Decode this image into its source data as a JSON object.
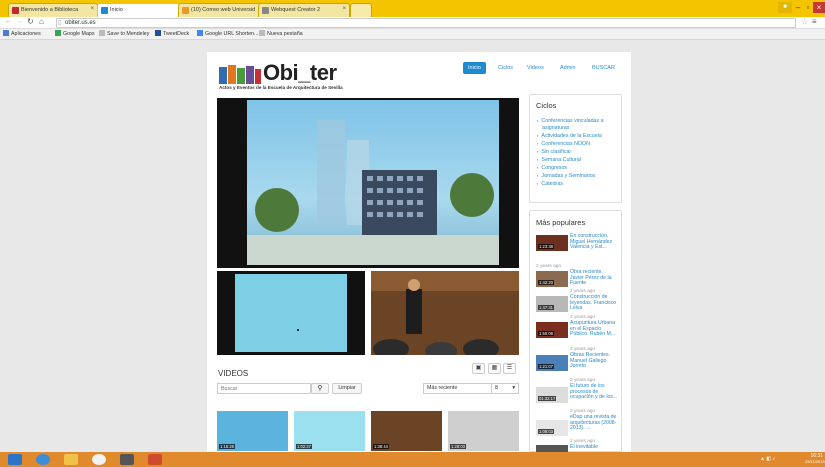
{
  "tabs": [
    {
      "label": "Bienvenido a Biblioteca",
      "color": "#c6262e"
    },
    {
      "label": "Inicio",
      "color": "#1e88d0",
      "active": true
    },
    {
      "label": "(10) Correo web Universid",
      "color": "#e89a2b"
    },
    {
      "label": "Webquest Creator 2",
      "color": "#888888"
    }
  ],
  "address": {
    "url": "obiter.us.es"
  },
  "bookmarks": [
    {
      "label": "Aplicaciones",
      "color": "#4a7bd6"
    },
    {
      "label": "Google Maps",
      "color": "#34a853"
    },
    {
      "label": "Save to Mendeley",
      "color": "#bbbbbb"
    },
    {
      "label": "TweetDeck",
      "color": "#1f4f9c"
    },
    {
      "label": "Google URL Shorten...",
      "color": "#4285f4"
    },
    {
      "label": "Nueva pestaña",
      "color": "#bbbbbb"
    }
  ],
  "site": {
    "logo_text": "Obi_ter",
    "tagline": "Actos y Eventos de la Escuela de Arquitectura de Sevilla",
    "nav": [
      "Inicio",
      "Ciclos",
      "Videos",
      "Admin",
      "BUSCAR"
    ]
  },
  "ciclos": {
    "title": "Ciclos",
    "items": [
      "Conferencias vinculadas a",
      "asignaturas",
      "Actividades de la Escuela",
      "Conferencias NOON",
      "Sin clasificar",
      "Semana Cultural",
      "Congresos",
      "Jornadas y Seminarios",
      "Cátedras"
    ]
  },
  "popular": {
    "title": "Más populares",
    "items": [
      {
        "title": "En construcción. Miguel Hernández Valencia y Est...",
        "duration": "1:23:38",
        "date": "2 years ago"
      },
      {
        "title": "Obra reciente. Javier Pérez de la Fuente",
        "duration": "1:42:20",
        "date": "2 years ago"
      },
      {
        "title": "Construcción de leyendas. Francisco Leiva",
        "duration": "1:47:31",
        "date": "2 years ago"
      },
      {
        "title": "Acupuntura Urbana en el Espacio Público. Rubén M...",
        "duration": "1:50:06",
        "date": "2 years ago"
      },
      {
        "title": "Obras Recientes. Manuel Gallego Jorreto",
        "duration": "1:21:07",
        "date": "2 years ago"
      },
      {
        "title": "El futuro de los procesos de ocupación y de los...",
        "duration": "01:32:17",
        "date": "2 years ago"
      },
      {
        "title": "eDap una revista de arquitecturas (2008-2013). ...",
        "duration": "1:08:03",
        "date": "2 years ago"
      },
      {
        "title": "El inevitable",
        "duration": "",
        "date": ""
      }
    ]
  },
  "videos": {
    "title": "VIDEOS",
    "search_placeholder": "Buscar",
    "clear_label": "Limpiar",
    "sort_value": "Más reciente",
    "per_page": "8",
    "thumbs": [
      "1:15:28",
      "1:02:27",
      "1:38:44",
      "1:28:03"
    ]
  },
  "taskbar": {
    "time": "16:31",
    "date": "25/11/2015"
  }
}
